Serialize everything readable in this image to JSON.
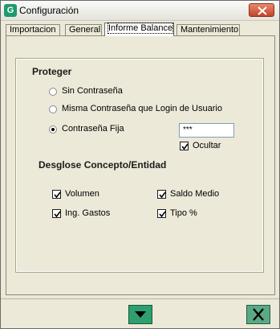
{
  "window": {
    "title": "Configuración"
  },
  "tabs": [
    {
      "label": "Importacion",
      "active": false
    },
    {
      "label": "General",
      "active": false
    },
    {
      "label": "Informe Balance",
      "active": true
    },
    {
      "label": "Mantenimiento",
      "active": false
    }
  ],
  "proteger": {
    "heading": "Proteger",
    "options": [
      {
        "label": "Sin Contraseña",
        "selected": false
      },
      {
        "label": "Misma Contraseña que Login de Usuario",
        "selected": false
      },
      {
        "label": "Contraseña Fija",
        "selected": true
      }
    ],
    "password_value": "***",
    "ocultar_label": "Ocultar",
    "ocultar_checked": true
  },
  "desglose": {
    "heading": "Desglose Concepto/Entidad",
    "items": [
      {
        "label": "Volumen",
        "checked": true
      },
      {
        "label": "Saldo Medio",
        "checked": true
      },
      {
        "label": "Ing. Gastos",
        "checked": true
      },
      {
        "label": "Tipo %",
        "checked": true
      }
    ]
  },
  "colors": {
    "accent": "#2f9f6f",
    "close": "#c0442a"
  },
  "icons": {
    "app": "app-logo-icon",
    "close": "close-icon",
    "confirm": "arrow-down-icon",
    "cancel": "x-icon"
  }
}
